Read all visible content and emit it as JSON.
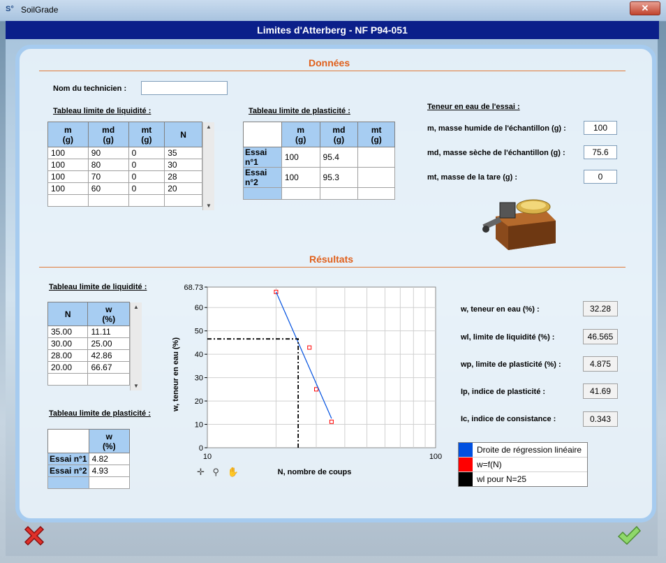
{
  "window": {
    "logo": "S°",
    "title": "SoilGrade",
    "close": "✕"
  },
  "header": {
    "title": "Limites d'Atterberg - NF P94-051"
  },
  "donnees": {
    "title": "Données",
    "technician_label": "Nom du technicien :",
    "technician_value": "",
    "liquidity_table": {
      "title": "Tableau limite de liquidité :",
      "headers": [
        [
          "m",
          "(g)"
        ],
        [
          "md",
          "(g)"
        ],
        [
          "mt",
          "(g)"
        ],
        [
          "N",
          ""
        ]
      ],
      "rows": [
        [
          "100",
          "90",
          "0",
          "35"
        ],
        [
          "100",
          "80",
          "0",
          "30"
        ],
        [
          "100",
          "70",
          "0",
          "28"
        ],
        [
          "100",
          "60",
          "0",
          "20"
        ]
      ]
    },
    "plasticity_table": {
      "title": "Tableau limite de plasticité :",
      "headers": [
        [
          "m",
          "(g)"
        ],
        [
          "md",
          "(g)"
        ],
        [
          "mt",
          "(g)"
        ]
      ],
      "rows": [
        {
          "label": "Essai n°1",
          "values": [
            "100",
            "95.4",
            ""
          ]
        },
        {
          "label": "Essai n°2",
          "values": [
            "100",
            "95.3",
            ""
          ]
        }
      ]
    },
    "water_content": {
      "title": "Teneur en eau de l'essai :",
      "m_label": "m, masse humide de l'échantillon (g) :",
      "m_value": "100",
      "md_label": "md, masse sèche de l'échantillon (g) :",
      "md_value": "75.6",
      "mt_label": "mt, masse de la tare (g) :",
      "mt_value": "0"
    }
  },
  "resultats": {
    "title": "Résultats",
    "liquidity_table": {
      "title": "Tableau limite de liquidité :",
      "headers": [
        [
          "N",
          ""
        ],
        [
          "w",
          "(%)"
        ]
      ],
      "rows": [
        [
          "35.00",
          "11.11"
        ],
        [
          "30.00",
          "25.00"
        ],
        [
          "28.00",
          "42.86"
        ],
        [
          "20.00",
          "66.67"
        ]
      ]
    },
    "plasticity_table": {
      "title": "Tableau limite de plasticité :",
      "header": [
        "w",
        "(%)"
      ],
      "rows": [
        {
          "label": "Essai n°1",
          "value": "4.82"
        },
        {
          "label": "Essai n°2",
          "value": "4.93"
        }
      ]
    },
    "values": {
      "w_label": "w, teneur en eau (%) :",
      "w_value": "32.28",
      "wl_label": "wl, limite de liquidité (%) :",
      "wl_value": "46.565",
      "wp_label": "wp, limite de plasticité (%) :",
      "wp_value": "4.875",
      "ip_label": "Ip, indice de plasticité :",
      "ip_value": "41.69",
      "ic_label": "Ic, indice de consistance :",
      "ic_value": "0.343"
    },
    "legend": [
      {
        "label": "Droite de régression linéaire",
        "color": "#0050e0"
      },
      {
        "label": "w=f(N)",
        "color": "#ff0000"
      },
      {
        "label": "wl pour N=25",
        "color": "#000000"
      }
    ],
    "zoom_tools": "✛ ⚲ ✋"
  },
  "chart_data": {
    "type": "scatter",
    "xlabel": "N, nombre de coups",
    "ylabel": "w, teneur en eau (%)",
    "x_scale": "log",
    "xlim": [
      10,
      100
    ],
    "ylim": [
      0,
      68.73
    ],
    "x_ticks": [
      "10",
      "100"
    ],
    "y_ticks": [
      "0",
      "10",
      "20",
      "30",
      "40",
      "50",
      "60",
      "68.73"
    ],
    "grid": true,
    "series": [
      {
        "name": "w=f(N)",
        "x": [
          35,
          30,
          28,
          20
        ],
        "y": [
          11.11,
          25.0,
          42.86,
          66.67
        ],
        "color": "#ff0000",
        "marker": "square"
      },
      {
        "name": "Droite de régression linéaire",
        "x": [
          20,
          35
        ],
        "y": [
          66.67,
          12.5
        ],
        "color": "#0050e0",
        "type": "line"
      },
      {
        "name": "wl pour N=25",
        "x": [
          10,
          25,
          25
        ],
        "y": [
          46.565,
          46.565,
          0
        ],
        "color": "#000000",
        "type": "dashdot"
      }
    ]
  },
  "buttons": {
    "cancel_icon": "cancel-x-icon",
    "ok_icon": "check-icon"
  }
}
